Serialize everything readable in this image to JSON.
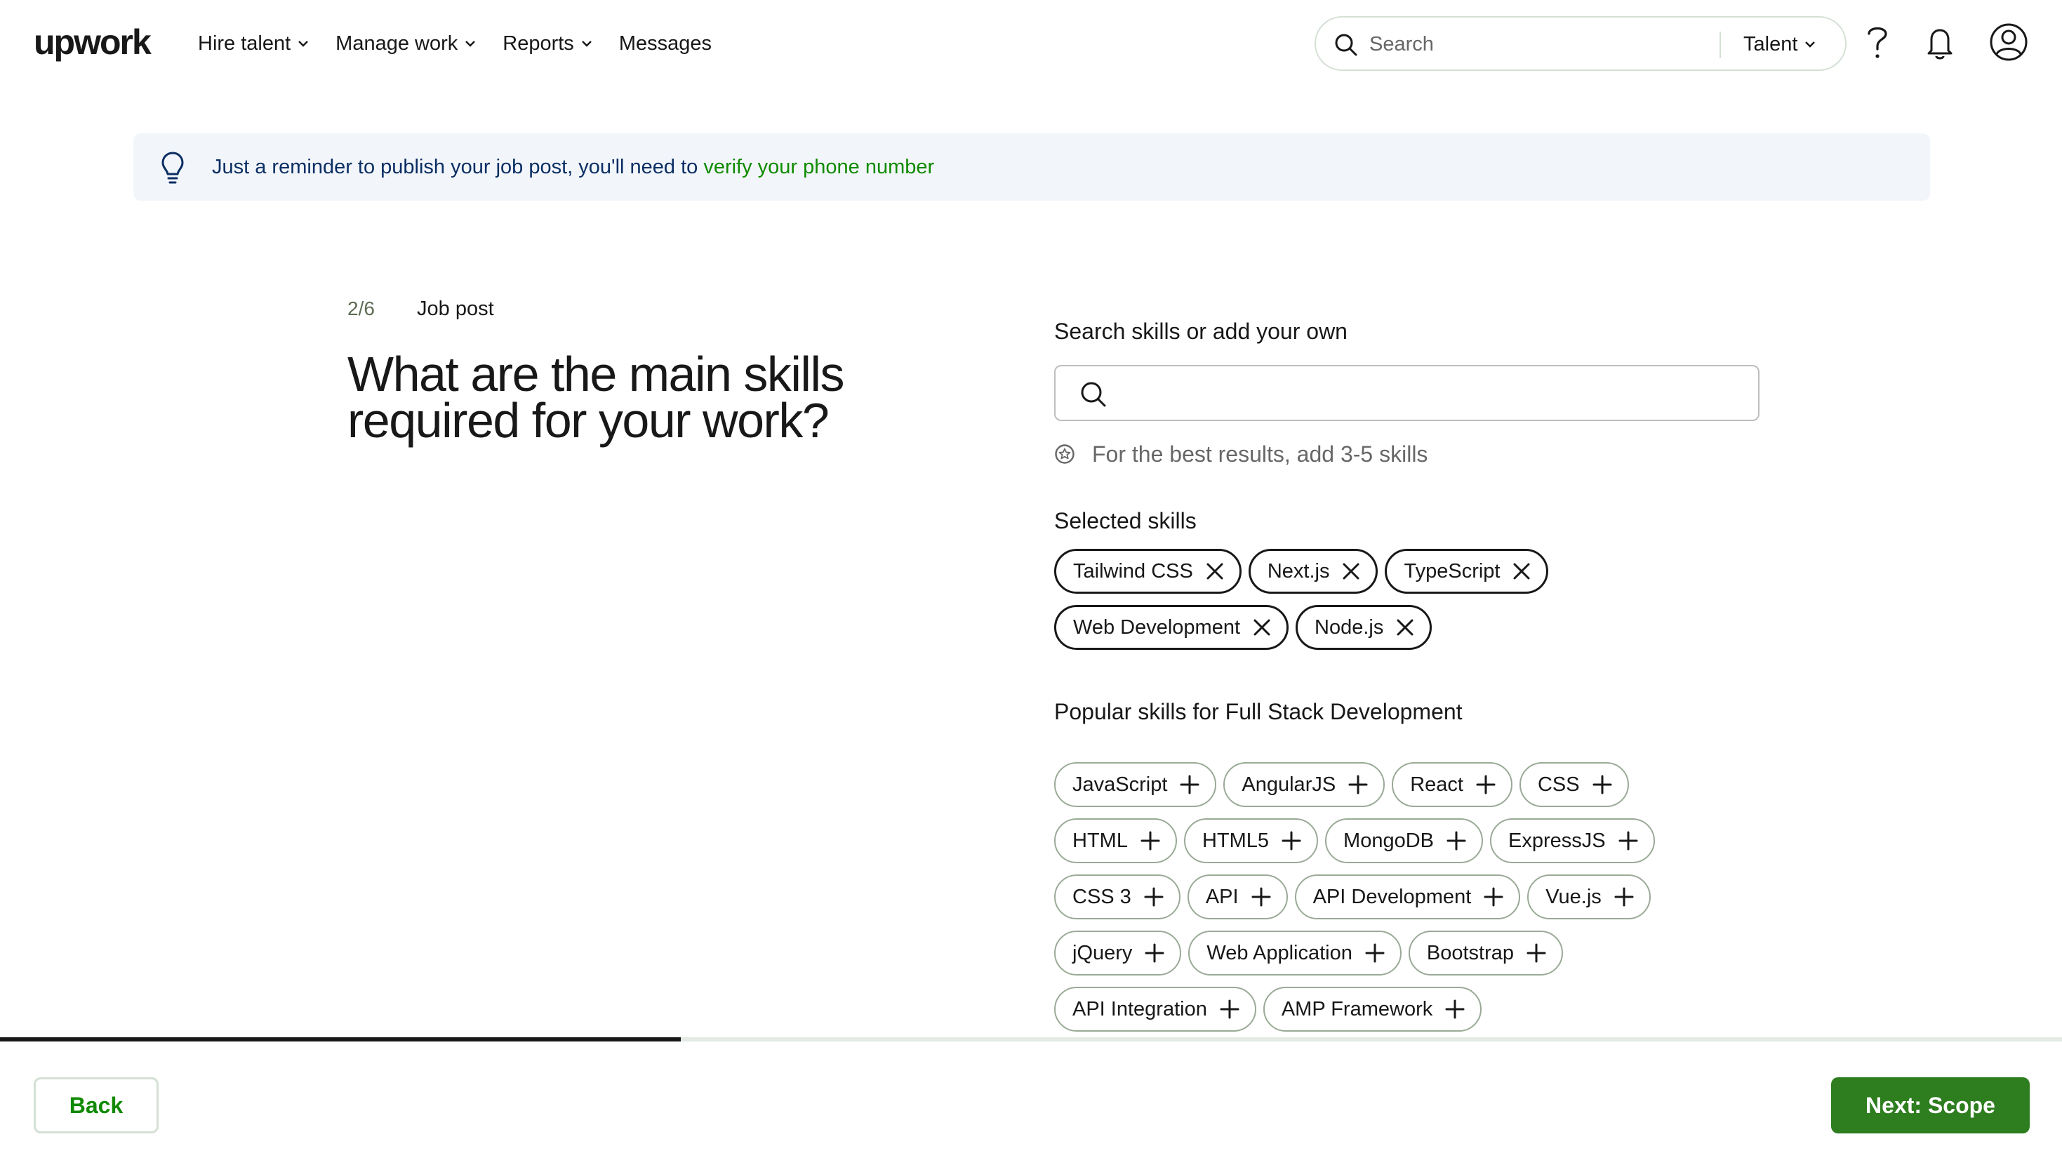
{
  "header": {
    "logo": "upwork",
    "nav": [
      {
        "label": "Hire talent",
        "icon": "chevron-down-icon"
      },
      {
        "label": "Manage work",
        "icon": "chevron-down-icon"
      },
      {
        "label": "Reports",
        "icon": "chevron-down-icon"
      },
      {
        "label": "Messages"
      }
    ],
    "search": {
      "placeholder": "Search",
      "value": "",
      "type_selected": "Talent"
    },
    "icons": [
      "help-icon",
      "bell-icon",
      "user-avatar-icon"
    ]
  },
  "banner": {
    "icon": "lightbulb-icon",
    "text": "Just a reminder to publish your job post, you'll need to ",
    "link": "verify your phone number"
  },
  "step": {
    "counter": "2/6",
    "label": "Job post"
  },
  "title": "What are the main skills required for your work?",
  "skill_search": {
    "label": "Search skills or add your own",
    "placeholder": "",
    "value": ""
  },
  "hint": "For the best results, add 3-5 skills",
  "selected": {
    "label": "Selected skills",
    "skills": [
      "Tailwind CSS",
      "Next.js",
      "TypeScript",
      "Web Development",
      "Node.js"
    ]
  },
  "popular": {
    "label": "Popular skills for Full Stack Development",
    "skills": [
      "JavaScript",
      "AngularJS",
      "React",
      "CSS",
      "HTML",
      "HTML5",
      "MongoDB",
      "ExpressJS",
      "CSS 3",
      "API",
      "API Development",
      "Vue.js",
      "jQuery",
      "Web Application",
      "Bootstrap",
      "API Integration",
      "AMP Framework"
    ]
  },
  "progress": {
    "step": 2,
    "total": 6,
    "fraction": 0.33
  },
  "footer": {
    "back_label": "Back",
    "next_label": "Next: Scope"
  },
  "colors": {
    "accent_green": "#108a00",
    "button_green": "#2e7d1f",
    "banner_bg": "#f2f6fb",
    "banner_text": "#0b2e63"
  }
}
